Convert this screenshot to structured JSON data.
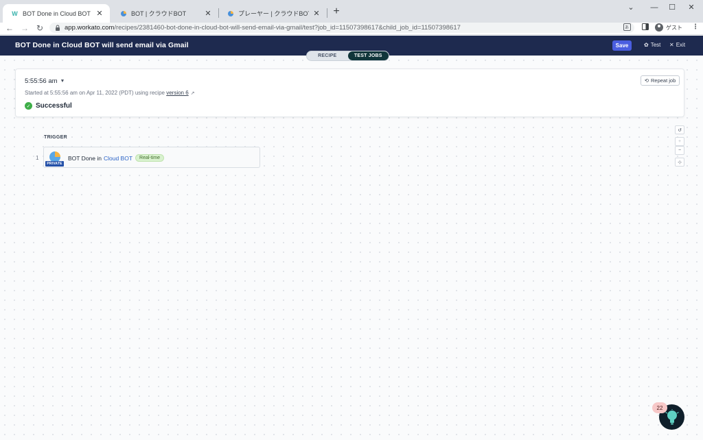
{
  "browser": {
    "tabs": [
      {
        "title": "BOT Done in Cloud BOT will send",
        "active": true
      },
      {
        "title": "BOT | クラウドBOT",
        "active": false
      },
      {
        "title": "プレーヤー | クラウドBOT",
        "active": false
      }
    ],
    "url_host": "app.workato.com",
    "url_path": "/recipes/2381460-bot-done-in-cloud-bot-will-send-email-via-gmail/test?job_id=11507398617&child_job_id=11507398617",
    "profile_label": "ゲスト"
  },
  "header": {
    "title": "BOT Done in Cloud BOT will send email via Gmail",
    "save_label": "Save",
    "test_label": "Test",
    "exit_label": "Exit",
    "bg_color": "#1e2a4f",
    "save_color": "#4a5ee0"
  },
  "mode_toggle": {
    "recipe_label": "RECIPE",
    "test_jobs_label": "TEST JOBS"
  },
  "job": {
    "time": "5:55:56 am",
    "started_prefix": "Started at 5:55:56 am on Apr 11, 2022 (PDT) using recipe ",
    "version_link": "version 6",
    "status": "Successful",
    "status_color": "#3fae49",
    "repeat_label": "Repeat job"
  },
  "recipe": {
    "section_label": "TRIGGER",
    "steps": [
      {
        "number": "1",
        "badge": "PRIVATE",
        "text_prefix": "BOT Done in",
        "app_name": "Cloud BOT",
        "tag": "Real-time"
      }
    ]
  },
  "helper": {
    "count": "22"
  }
}
